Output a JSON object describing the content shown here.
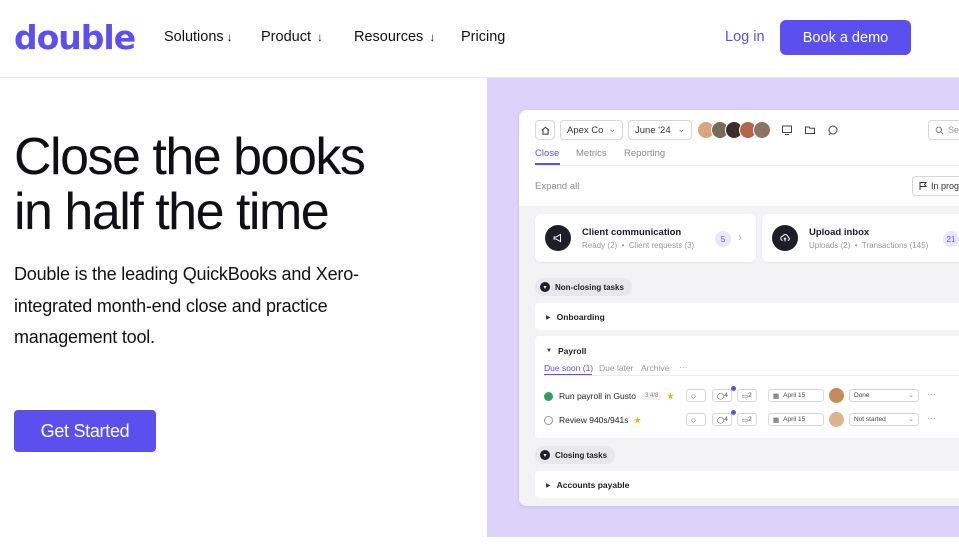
{
  "nav": {
    "logo": "double",
    "links": [
      {
        "label": "Solutions",
        "arrow": "↓"
      },
      {
        "label": "Product",
        "arrow": "↓"
      },
      {
        "label": "Resources",
        "arrow": "↓"
      },
      {
        "label": "Pricing",
        "arrow": ""
      }
    ],
    "login": "Log in",
    "demo": "Book a demo"
  },
  "hero": {
    "title_line1": "Close the books",
    "title_line2": "in half the time",
    "subtitle": "Double is the leading QuickBooks and Xero-integrated month-end close and practice management tool.",
    "cta": "Get Started"
  },
  "colors": {
    "accent": "#5b4ff0",
    "panel_bg": "#dcd3fb"
  },
  "app": {
    "client_select": "Apex Co",
    "month_select": "June '24",
    "search_placeholder": "Se",
    "tabs": [
      "Close",
      "Metrics",
      "Reporting"
    ],
    "expand": "Expand all",
    "in_progress": "In prog",
    "cards": [
      {
        "title": "Client communication",
        "meta1": "Ready (2)",
        "meta2": "Client requests (3)",
        "badge": "5",
        "icon": "megaphone-icon"
      },
      {
        "title": "Upload inbox",
        "meta1": "Uploads (2)",
        "meta2": "Transactions (145)",
        "badge": "21",
        "icon": "upload-cloud-icon"
      }
    ],
    "non_closing": "Non-closing tasks",
    "onboarding": "Onboarding",
    "payroll": "Payroll",
    "subtabs": [
      "Due soon (1)",
      "Due later",
      "Archive",
      "···"
    ],
    "tasks": [
      {
        "name": "Run payroll in Gusto",
        "tag": "3 4/8",
        "comments": "4",
        "files": "2",
        "date": "April 15",
        "status": "Done",
        "done": true
      },
      {
        "name": "Review 940s/941s",
        "tag": "",
        "comments": "4",
        "files": "2",
        "date": "April 15",
        "status": "Not started",
        "done": false
      }
    ],
    "closing": "Closing tasks",
    "accounts_payable": "Accounts payable"
  }
}
